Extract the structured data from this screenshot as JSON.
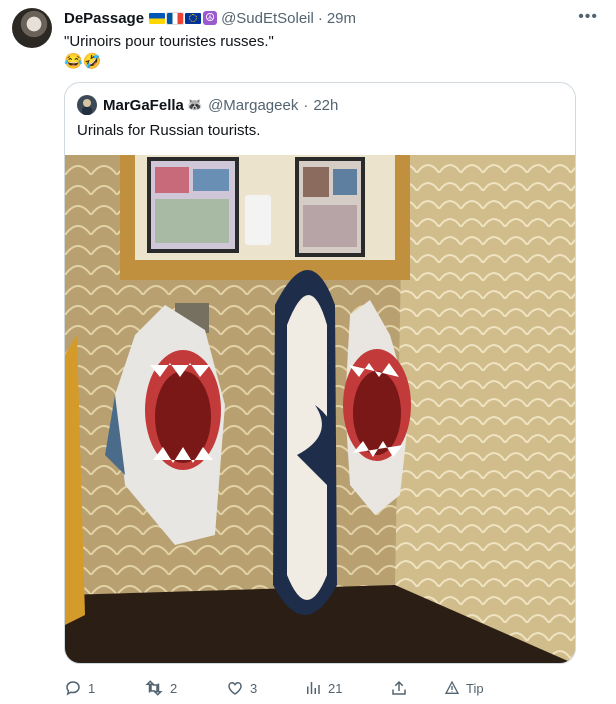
{
  "author": {
    "display_name": "DePassage",
    "handle": "@SudEtSoleil",
    "time": "29m"
  },
  "tweet": {
    "text": "\"Urinoirs pour touristes russes.\"",
    "emojis": "😂🤣"
  },
  "quoted": {
    "display_name": "MarGaFella",
    "badge_emoji": "🦝",
    "handle": "@Margageek",
    "time": "22h",
    "text": "Urinals for Russian tourists."
  },
  "actions": {
    "replies": "1",
    "retweets": "2",
    "likes": "3",
    "views": "21",
    "tip_label": "Tip"
  },
  "icons": [
    "more-icon",
    "reply-icon",
    "retweet-icon",
    "like-icon",
    "views-icon",
    "share-icon",
    "tip-icon"
  ],
  "colors": {
    "text": "#0f1419",
    "muted": "#536471",
    "border": "#cfd9de"
  }
}
